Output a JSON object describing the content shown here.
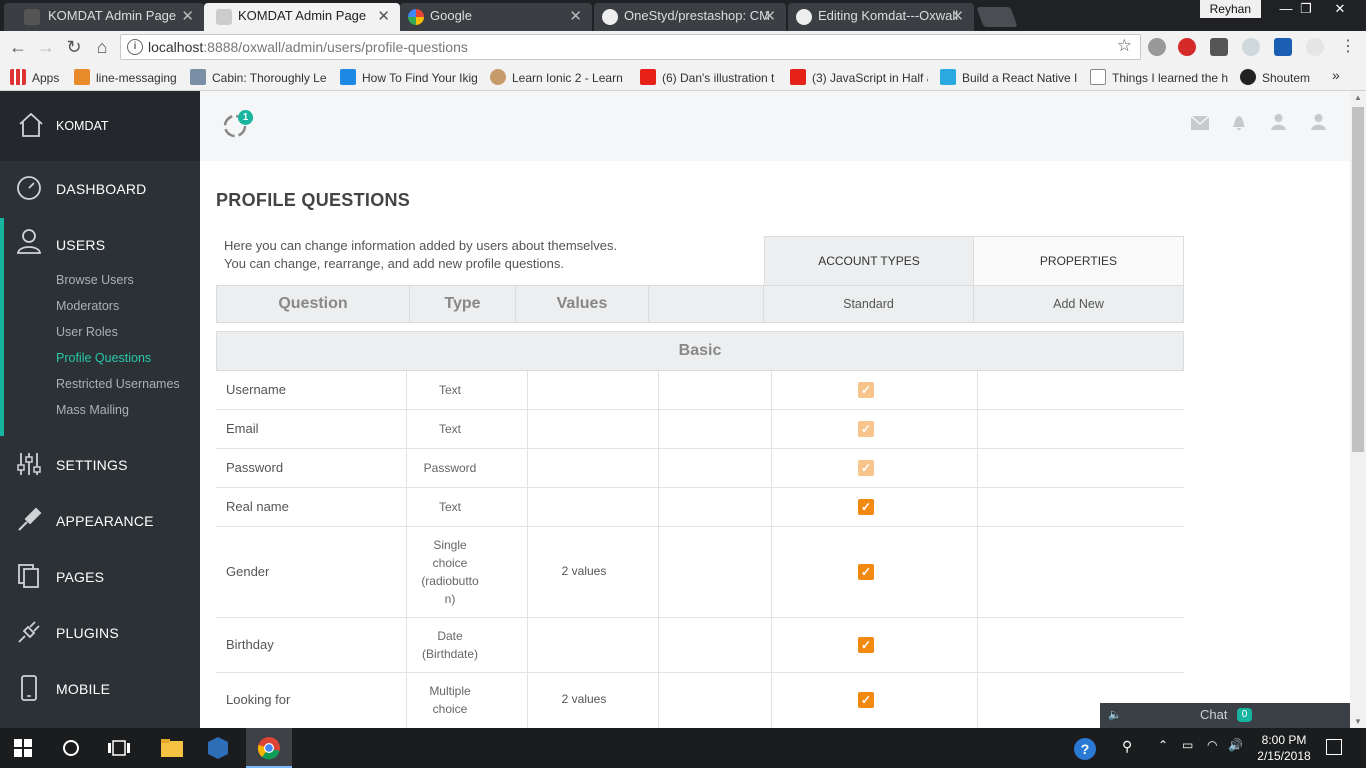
{
  "browser": {
    "tabs": [
      {
        "label": "KOMDAT Admin Page",
        "active": false
      },
      {
        "label": "KOMDAT Admin Page",
        "active": true
      },
      {
        "label": "Google",
        "active": false
      },
      {
        "label": "OneStyd/prestashop: CM",
        "active": false
      },
      {
        "label": "Editing Komdat---Oxwall",
        "active": false
      }
    ],
    "profile_user": "Reyhan",
    "url_host": "localhost",
    "url_path": ":8888/oxwall/admin/users/profile-questions",
    "bookmarks": [
      {
        "label": "Apps"
      },
      {
        "label": "line-messaging"
      },
      {
        "label": "Cabin: Thoroughly Le"
      },
      {
        "label": "How To Find Your Ikig"
      },
      {
        "label": "Learn Ionic 2 - Learn"
      },
      {
        "label": "(6) Dan's illustration t"
      },
      {
        "label": "(3) JavaScript in Half a"
      },
      {
        "label": "Build a React Native I"
      },
      {
        "label": "Things I learned the h"
      },
      {
        "label": "Shoutem"
      }
    ],
    "bookmarks_overflow": "»"
  },
  "sidebar": {
    "brand": "KOMDAT",
    "dashboard": "DASHBOARD",
    "users": "USERS",
    "users_sub": [
      {
        "label": "Browse Users",
        "active": false
      },
      {
        "label": "Moderators",
        "active": false
      },
      {
        "label": "User Roles",
        "active": false
      },
      {
        "label": "Profile Questions",
        "active": true
      },
      {
        "label": "Restricted Usernames",
        "active": false
      },
      {
        "label": "Mass Mailing",
        "active": false
      }
    ],
    "settings": "SETTINGS",
    "appearance": "APPEARANCE",
    "pages": "PAGES",
    "plugins": "PLUGINS",
    "mobile": "MOBILE"
  },
  "topbar": {
    "notification_count": "1"
  },
  "page": {
    "title": "PROFILE QUESTIONS",
    "desc_line1": "Here you can change information added by users about themselves.",
    "desc_line2": "You can change, rearrange, and add new profile questions.",
    "btn_account_types": "ACCOUNT TYPES",
    "btn_properties": "PROPERTIES"
  },
  "table": {
    "headers": {
      "question": "Question",
      "type": "Type",
      "values": "Values",
      "standard": "Standard",
      "add_new": "Add New"
    },
    "section": "Basic",
    "rows": [
      {
        "question": "Username",
        "type": "Text",
        "values": "",
        "checked": true,
        "disabled": true
      },
      {
        "question": "Email",
        "type": "Text",
        "values": "",
        "checked": true,
        "disabled": true
      },
      {
        "question": "Password",
        "type": "Password",
        "values": "",
        "checked": true,
        "disabled": true
      },
      {
        "question": "Real name",
        "type": "Text",
        "values": "",
        "checked": true,
        "disabled": false
      },
      {
        "question": "Gender",
        "type_lines": [
          "Single",
          "choice",
          "(radiobutto",
          "n)"
        ],
        "values": "2 values",
        "checked": true,
        "disabled": false
      },
      {
        "question": "Birthday",
        "type_lines": [
          "Date",
          "(Birthdate)"
        ],
        "values": "",
        "checked": true,
        "disabled": false
      },
      {
        "question": "Looking for",
        "type_lines": [
          "Multiple",
          "choice"
        ],
        "values": "2 values",
        "checked": true,
        "disabled": false
      }
    ]
  },
  "chat": {
    "label": "Chat",
    "count": "0"
  },
  "taskbar": {
    "time": "8:00 PM",
    "date": "2/15/2018"
  },
  "colors": {
    "accent": "#17b5a0",
    "checkbox": "#f28a12",
    "sidebar": "#2c3136"
  }
}
